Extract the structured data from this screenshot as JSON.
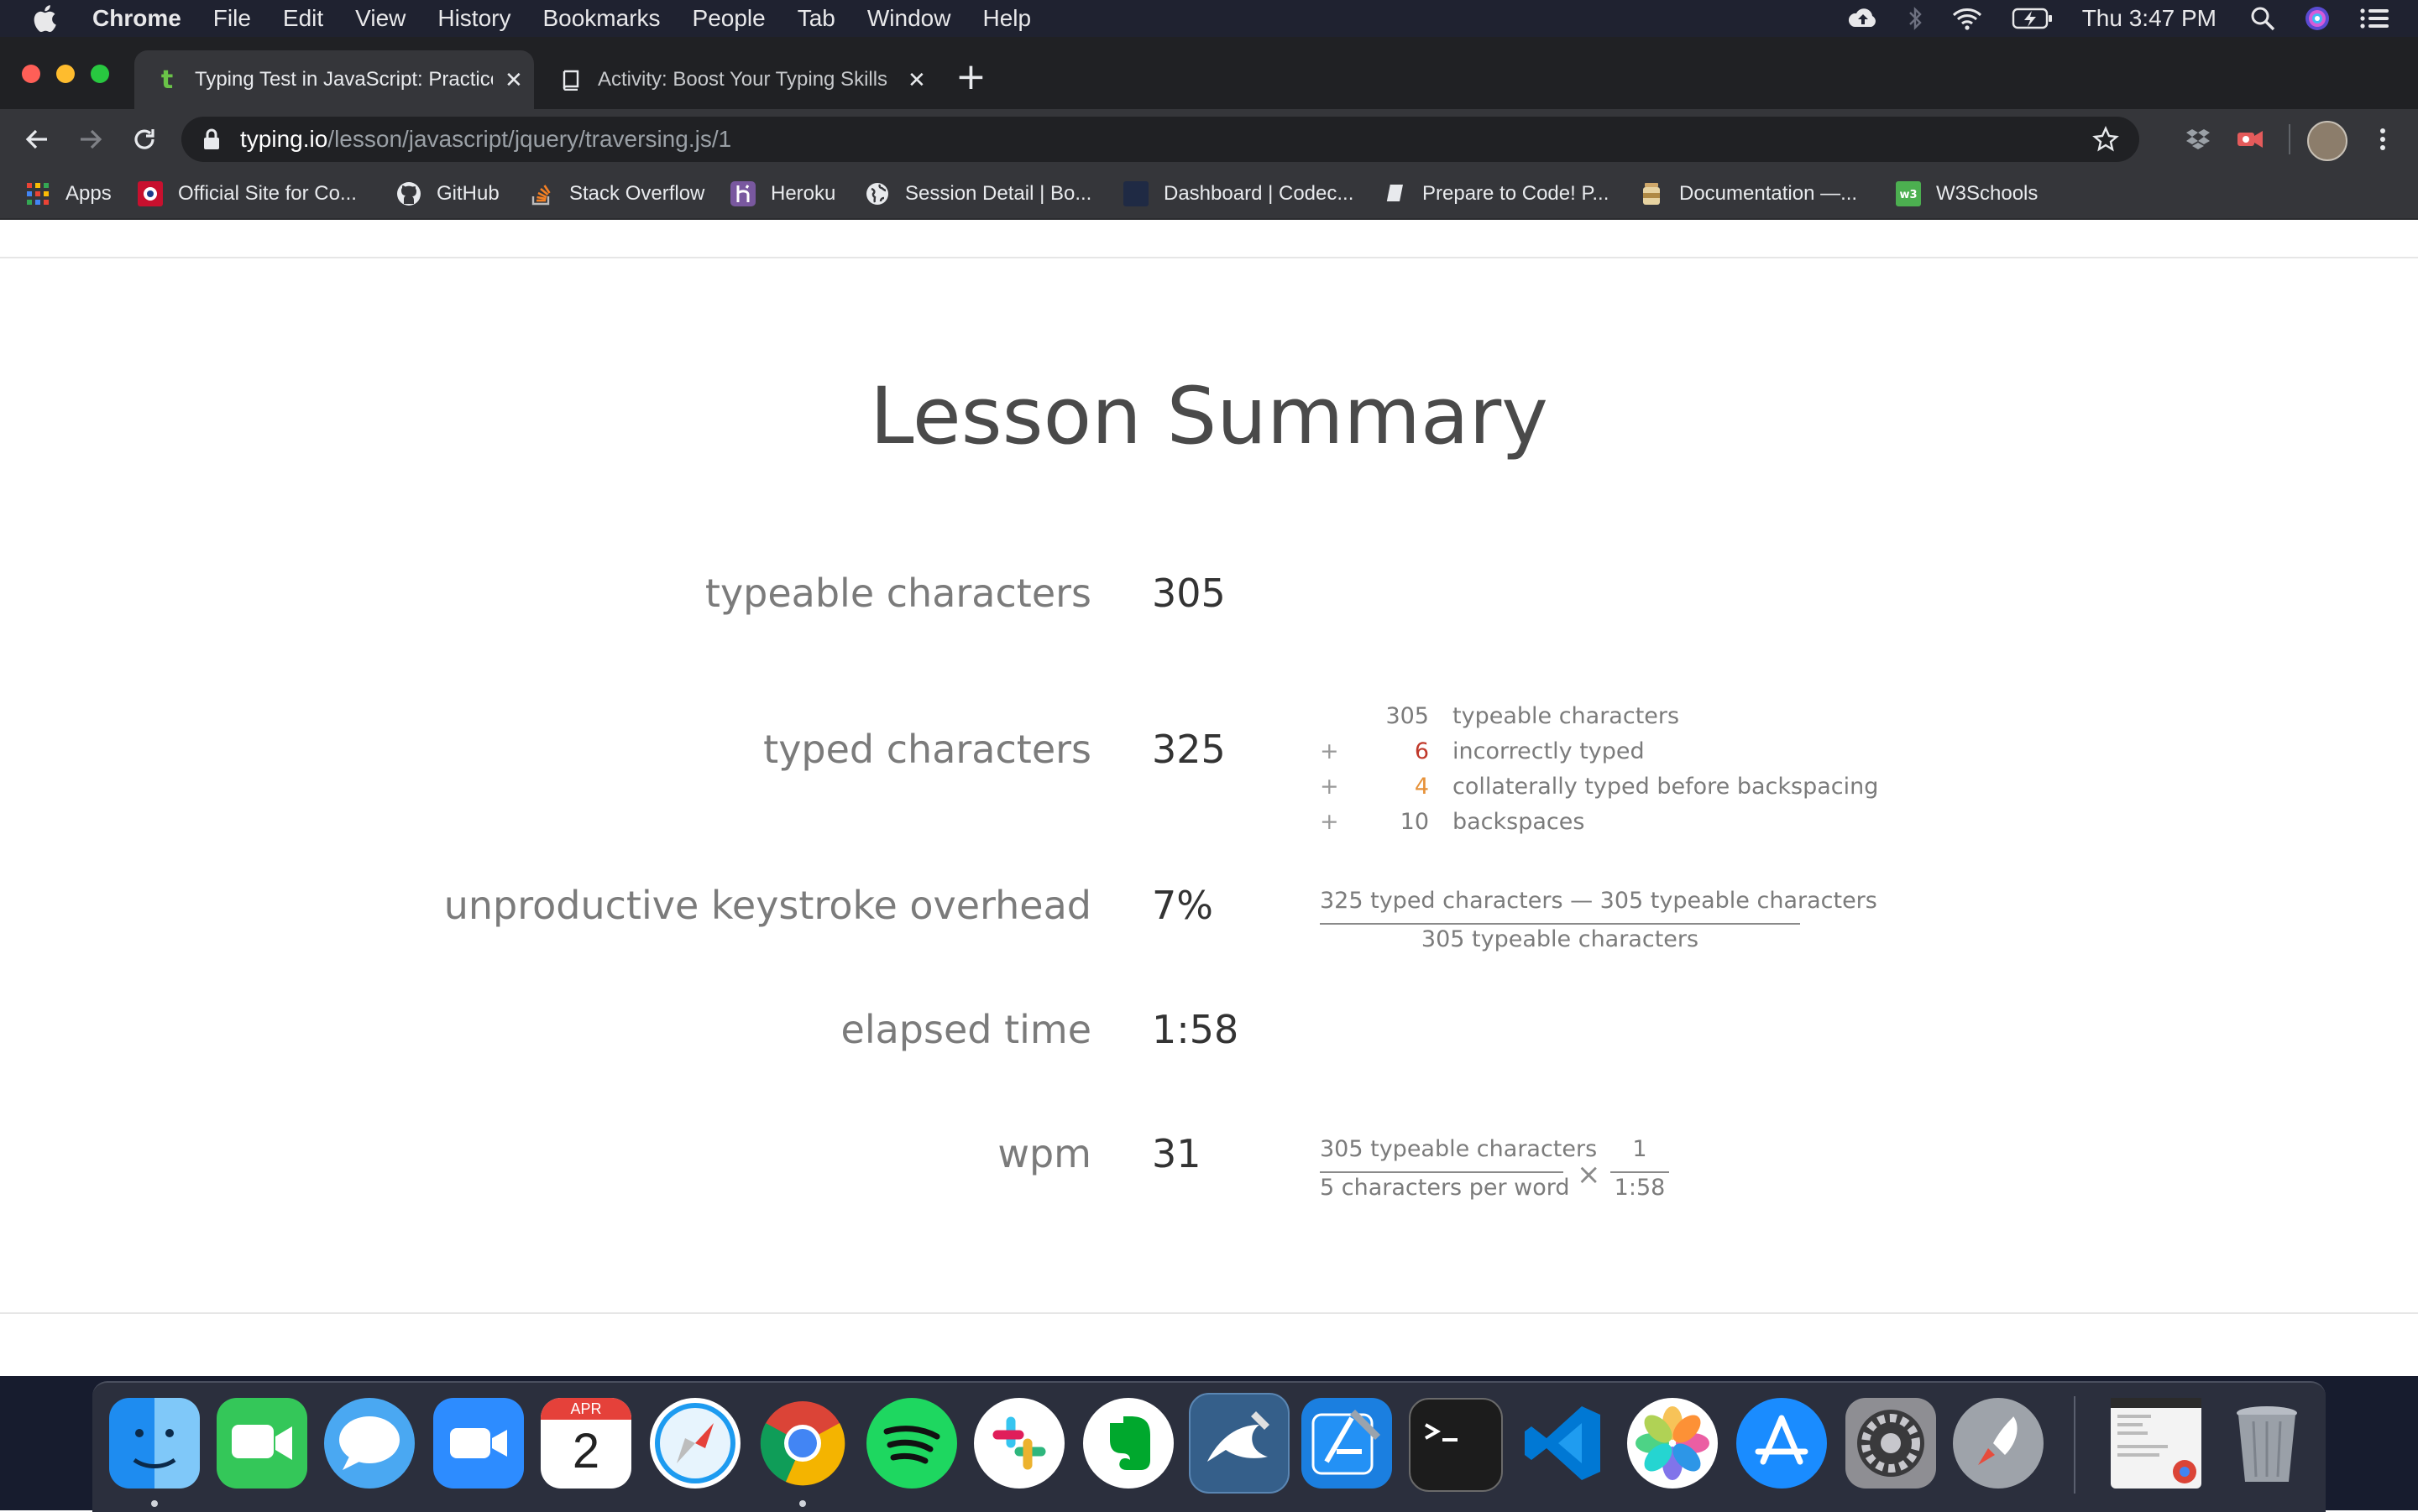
{
  "menubar": {
    "app_name": "Chrome",
    "items": [
      "File",
      "Edit",
      "View",
      "History",
      "Bookmarks",
      "People",
      "Tab",
      "Window",
      "Help"
    ],
    "clock": "Thu 3:47 PM"
  },
  "tabs": [
    {
      "title": "Typing Test in JavaScript: Practice",
      "active": true,
      "favicon": "t"
    },
    {
      "title": "Activity: Boost Your Typing Skills",
      "active": false
    }
  ],
  "address_bar": {
    "host": "typing.io",
    "path": "/lesson/javascript/jquery/traversing.js/1"
  },
  "bookmarks": [
    "Apps",
    "Official Site for Co...",
    "GitHub",
    "Stack Overflow",
    "Heroku",
    "Session Detail | Bo...",
    "Dashboard | Codec...",
    "Prepare to Code! P...",
    "Documentation —...",
    "W3Schools"
  ],
  "summary": {
    "title": "Lesson Summary",
    "typeable": {
      "label": "typeable characters",
      "value": "305"
    },
    "typed": {
      "label": "typed characters",
      "value": "325",
      "breakdown": [
        {
          "op": "",
          "num": "305",
          "text": "typeable characters",
          "color": "#7b7b7b"
        },
        {
          "op": "+",
          "num": "6",
          "text": "incorrectly typed",
          "color": "#c0392b"
        },
        {
          "op": "+",
          "num": "4",
          "text": "collaterally typed before backspacing",
          "color": "#e69138"
        },
        {
          "op": "+",
          "num": "10",
          "text": "backspaces",
          "color": "#7b7b7b"
        }
      ]
    },
    "overhead": {
      "label": "unproductive keystroke overhead",
      "value": "7%",
      "numerator": "325 typed characters — 305 typeable characters",
      "denominator": "305 typeable characters"
    },
    "elapsed": {
      "label": "elapsed time",
      "value": "1:58"
    },
    "wpm": {
      "label": "wpm",
      "value": "31",
      "frac1_num": "305 typeable characters",
      "frac1_den": "5 characters per word",
      "times": "×",
      "frac2_num": "1",
      "frac2_den": "1:58"
    }
  },
  "dock": {
    "apps": [
      "finder",
      "facetime",
      "messages",
      "zoom",
      "calendar",
      "safari",
      "chrome",
      "spotify",
      "slack",
      "evernote",
      "mysql-workbench",
      "xcode",
      "terminal",
      "vscode",
      "photos",
      "app-store",
      "system-preferences",
      "launchpad",
      "document-preview",
      "trash"
    ],
    "calendar_month": "APR",
    "calendar_day": "2"
  }
}
